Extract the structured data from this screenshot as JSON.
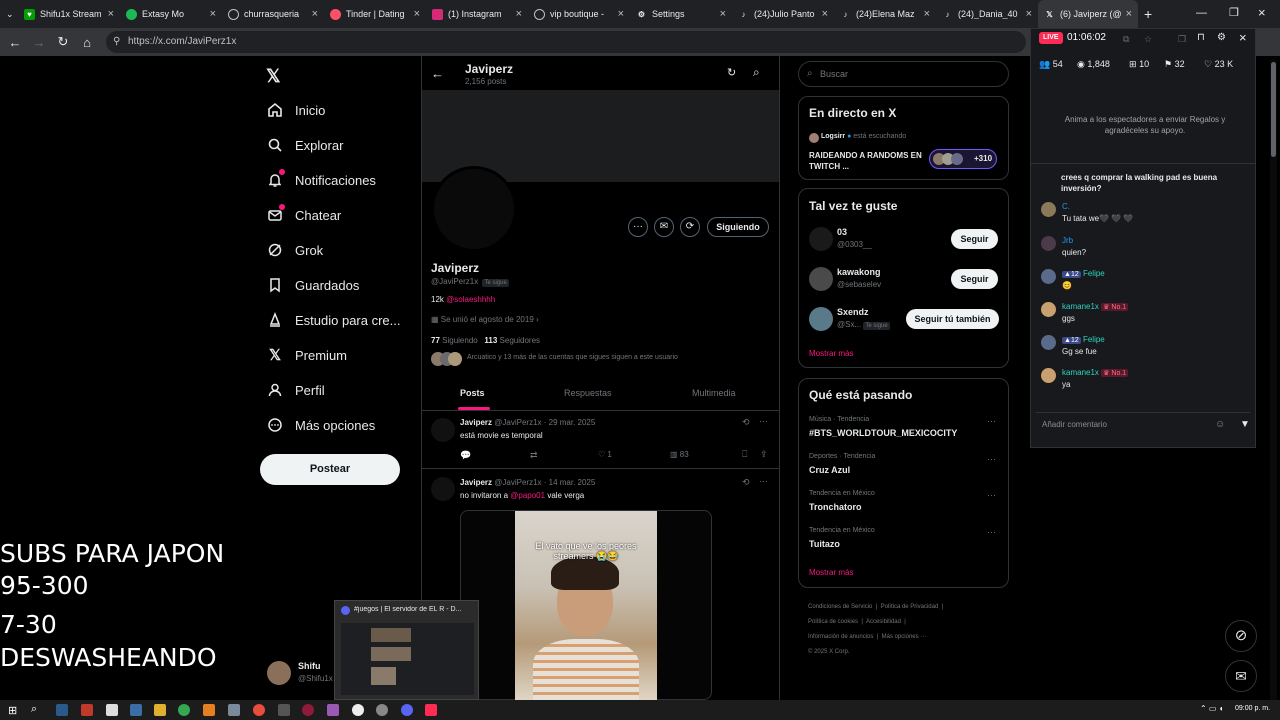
{
  "browser": {
    "tabs": [
      {
        "label": "Shifu1x Stream",
        "color": "#00a000"
      },
      {
        "label": "Extasy Mo",
        "color": "#1db954"
      },
      {
        "label": "churrasqueria",
        "color": "#5f6368"
      },
      {
        "label": "Tinder | Dating",
        "color": "#fd5068"
      },
      {
        "label": "(1) Instagram",
        "color": "#d62976"
      },
      {
        "label": "vip boutique -",
        "color": "#5f6368"
      },
      {
        "label": "Settings",
        "color": "#5f6368"
      },
      {
        "label": "(24)Julio Panto",
        "color": "#000000"
      },
      {
        "label": "(24)Elena Maz",
        "color": "#000000"
      },
      {
        "label": "(24)_Dania_40",
        "color": "#000000"
      },
      {
        "label": "(6) Javiperz (@",
        "color": "#000000"
      }
    ],
    "url": "https://x.com/JaviPerz1x"
  },
  "nav": {
    "items": [
      {
        "label": "Inicio",
        "icon": "home-icon"
      },
      {
        "label": "Explorar",
        "icon": "search-icon"
      },
      {
        "label": "Notificaciones",
        "icon": "bell-icon"
      },
      {
        "label": "Chatear",
        "icon": "mail-icon"
      },
      {
        "label": "Grok",
        "icon": "grok-icon"
      },
      {
        "label": "Guardados",
        "icon": "bookmark-icon"
      },
      {
        "label": "Estudio para cre...",
        "icon": "studio-icon"
      },
      {
        "label": "Premium",
        "icon": "x-logo-icon"
      },
      {
        "label": "Perfil",
        "icon": "person-icon"
      },
      {
        "label": "Más opciones",
        "icon": "more-icon"
      }
    ],
    "post_button": "Postear"
  },
  "overlay": {
    "line1": "SUBS PARA JAPON",
    "line2": "95-300",
    "line3": "7-30",
    "line4": "DESWASHEANDO",
    "account_name": "Shifu",
    "account_handle": "@Shifu1x"
  },
  "profile": {
    "header_name": "Javiperz",
    "header_posts": "2,156 posts",
    "follow_button": "Siguiendo",
    "name": "Javiperz",
    "handle": "@JaviPerz1x",
    "follows_you": "Te sigue",
    "bio_count": "12k",
    "bio_link": "@solaeshhhh",
    "joined": "Se unió el agosto de 2019",
    "following_count": "77",
    "following_label": "Siguiendo",
    "followers_count": "113",
    "followers_label": "Seguidores",
    "followed_by": "Arcuatico y 13 más de las cuentas que sigues siguen a este usuario",
    "tabs": [
      "Posts",
      "Respuestas",
      "Multimedia"
    ]
  },
  "posts": [
    {
      "name": "Javiperz",
      "meta": "@JaviPerz1x · 29 mar. 2025",
      "text": "está movie es temporal",
      "likes": "1",
      "views": "83"
    },
    {
      "name": "Javiperz",
      "meta": "@JaviPerz1x · 14 mar. 2025",
      "text_before": "no invitaron a",
      "mention": "@papo01",
      "text_after": "vale verga",
      "video_caption": "El vato que ve los peores streamers 😭😂"
    }
  ],
  "discord_preview": {
    "title": "#juegos | El servidor de EL R - D..."
  },
  "search": {
    "placeholder": "Buscar"
  },
  "live_card": {
    "title": "En directo en X",
    "host": "Logsirr",
    "listening": "está escuchando",
    "stream_title": "RAIDEANDO A RANDOMS EN TWITCH ...",
    "extra_count": "+310"
  },
  "suggestions": {
    "title": "Tal vez te guste",
    "users": [
      {
        "name": "03",
        "handle": "@0303__",
        "button": "Seguir"
      },
      {
        "name": "kawakong",
        "handle": "@sebaselev",
        "button": "Seguir"
      },
      {
        "name": "Sxendz",
        "handle": "@Sx...",
        "tag": "Te sigue",
        "button": "Seguir tú también"
      }
    ],
    "more": "Mostrar más"
  },
  "trends": {
    "title": "Qué está pasando",
    "items": [
      {
        "category": "Música · Tendencia",
        "name": "#BTS_WORLDTOUR_MEXICOCITY"
      },
      {
        "category": "Deportes · Tendencia",
        "name": "Cruz Azul"
      },
      {
        "category": "Tendencia en México",
        "name": "Tronchatoro"
      },
      {
        "category": "Tendencia en México",
        "name": "Tuitazo"
      }
    ],
    "more": "Mostrar más"
  },
  "footer": {
    "links": [
      "Condiciones de Servicio",
      "Política de Privacidad",
      "Política de cookies",
      "Accesibilidad",
      "Información de anuncios",
      "Más opciones ···"
    ],
    "copyright": "© 2025 X Corp."
  },
  "live_panel": {
    "live_badge": "LIVE",
    "timer": "01:06:02",
    "stats": [
      {
        "icon": "people-icon",
        "value": "54"
      },
      {
        "icon": "eye-icon",
        "value": "1,848"
      },
      {
        "icon": "gift-icon",
        "value": "10"
      },
      {
        "icon": "share-icon",
        "value": "32"
      },
      {
        "icon": "heart-icon",
        "value": "23 K"
      }
    ],
    "hint": "Anima a los espectadores a enviar Regalos y agradéceles su apoyo.",
    "pinned_question": "crees q comprar la walking pad es buena inversión?",
    "messages": [
      {
        "user": "C.",
        "text": "Tu tata we🖤 🖤 🖤",
        "badge": "",
        "avatar": "#8a7a5a"
      },
      {
        "user": "Jrb",
        "text": "quien?",
        "badge": "",
        "avatar": "#4a3a4a"
      },
      {
        "user": "Felipe",
        "text": "😊",
        "badge": "12",
        "avatar": "#5a6a8a"
      },
      {
        "user": "kamane1x",
        "text": "ggs",
        "badge": "No.1",
        "avatar": "#c9a070"
      },
      {
        "user": "Felipe",
        "text": "Gg se fue",
        "badge": "12",
        "avatar": "#5a6a8a"
      },
      {
        "user": "kamane1x",
        "text": "ya",
        "badge": "No.1",
        "avatar": "#c9a070"
      }
    ],
    "comment_placeholder": "Añadir comentario"
  },
  "taskbar": {
    "time": "09:00 p. m."
  }
}
